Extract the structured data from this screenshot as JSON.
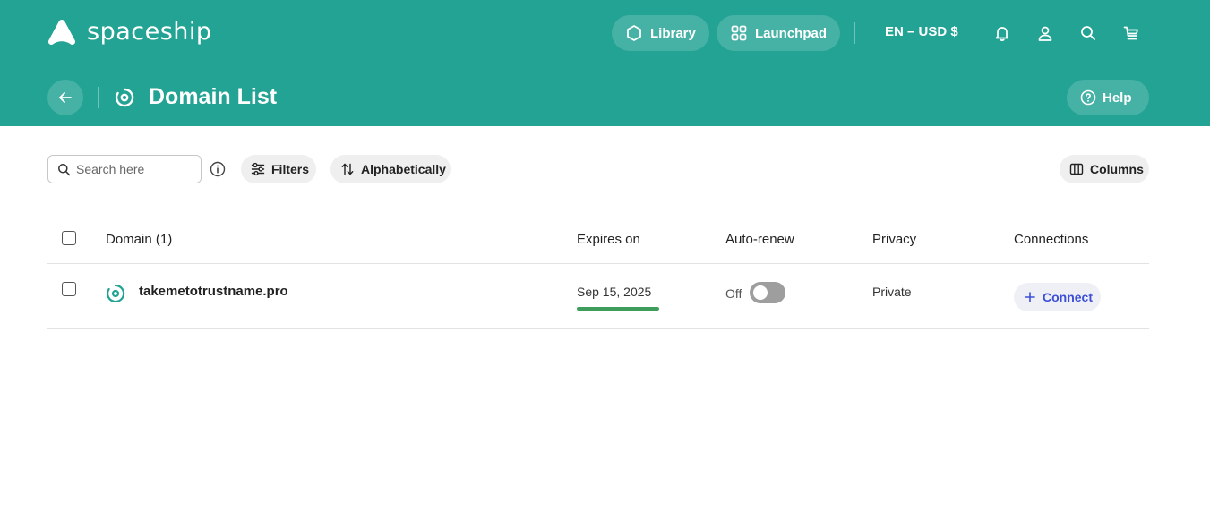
{
  "app": {
    "brand": "spaceship",
    "accent_color": "#23a394",
    "icon": "spaceship-logo-icon"
  },
  "header": {
    "nav": [
      {
        "label": "Library",
        "icon": "hexagon-icon"
      },
      {
        "label": "Launchpad",
        "icon": "grid-icon"
      }
    ],
    "locale": "EN – USD $",
    "icons": [
      "bell-icon",
      "user-icon",
      "search-icon",
      "cart-icon"
    ]
  },
  "page": {
    "title": "Domain List",
    "title_icon": "domain-target-icon",
    "back_icon": "arrow-left-icon",
    "help_label": "Help"
  },
  "toolbar": {
    "search_placeholder": "Search here",
    "filters_label": "Filters",
    "sort_label": "Alphabetically",
    "columns_label": "Columns"
  },
  "table": {
    "columns": [
      "Domain (1)",
      "Expires on",
      "Auto-renew",
      "Privacy",
      "Connections"
    ],
    "rows": [
      {
        "domain": "takemetotrustname.pro",
        "expires_on": "Sep 15, 2025",
        "expiry_progress": 1.0,
        "expiry_color": "#3f9d5c",
        "auto_renew_label": "Off",
        "auto_renew_on": false,
        "privacy": "Private",
        "connect_label": "Connect"
      }
    ]
  }
}
